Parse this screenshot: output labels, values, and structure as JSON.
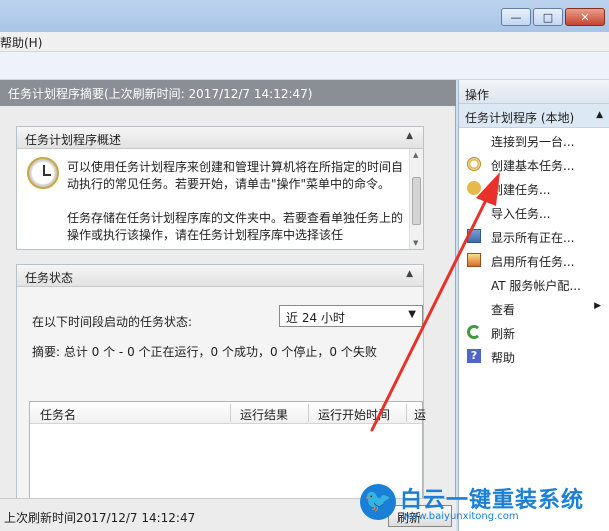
{
  "window": {
    "minimize_glyph": "—",
    "maximize_glyph": "□",
    "close_glyph": "✕"
  },
  "menubar": {
    "help": "帮助(H)"
  },
  "center": {
    "summary_title": "任务计划程序摘要(上次刷新时间: 2017/12/7 14:12:47)",
    "overview": {
      "title": "任务计划程序概述",
      "text1": "可以使用任务计划程序来创建和管理计算机将在所指定的时间自动执行的常见任务。若要开始，请单击\"操作\"菜单中的命令。",
      "text2": "任务存储在任务计划程序库的文件夹中。若要查看单独任务上的操作或执行该操作，请在任务计划程序库中选择该任"
    },
    "status": {
      "title": "任务状态",
      "label": "在以下时间段启动的任务状态:",
      "period_selected": "近 24 小时",
      "summary": "摘要: 总计 0 个 - 0 个正在运行，0 个成功，0 个停止，0 个失败",
      "columns": [
        "任务名",
        "运行结果",
        "运行开始时间",
        "运"
      ]
    },
    "footer": {
      "last_refresh": "上次刷新时间2017/12/7 14:12:47",
      "refresh_button": "刷新"
    }
  },
  "actions": {
    "header": "操作",
    "group": "任务计划程序 (本地)",
    "items": [
      {
        "label": "连接到另一台...",
        "icon": "none"
      },
      {
        "label": "创建基本任务...",
        "icon": "clock-star-icon"
      },
      {
        "label": "创建任务...",
        "icon": "clock-icon"
      },
      {
        "label": "导入任务...",
        "icon": "none"
      },
      {
        "label": "显示所有正在...",
        "icon": "display-icon"
      },
      {
        "label": "启用所有任务...",
        "icon": "enable-icon"
      },
      {
        "label": "AT 服务帐户配...",
        "icon": "none"
      },
      {
        "label": "查看",
        "icon": "none"
      },
      {
        "label": "刷新",
        "icon": "refresh-icon"
      },
      {
        "label": "帮助",
        "icon": "help-icon"
      }
    ]
  },
  "watermark": {
    "brand_cn": "白云一键重装系统",
    "brand_en": "www.baiyunxitong.com",
    "logo_glyph": "🐦"
  },
  "colors": {
    "annotation_arrow": "#e8312a",
    "brand": "#1a7fd6"
  }
}
